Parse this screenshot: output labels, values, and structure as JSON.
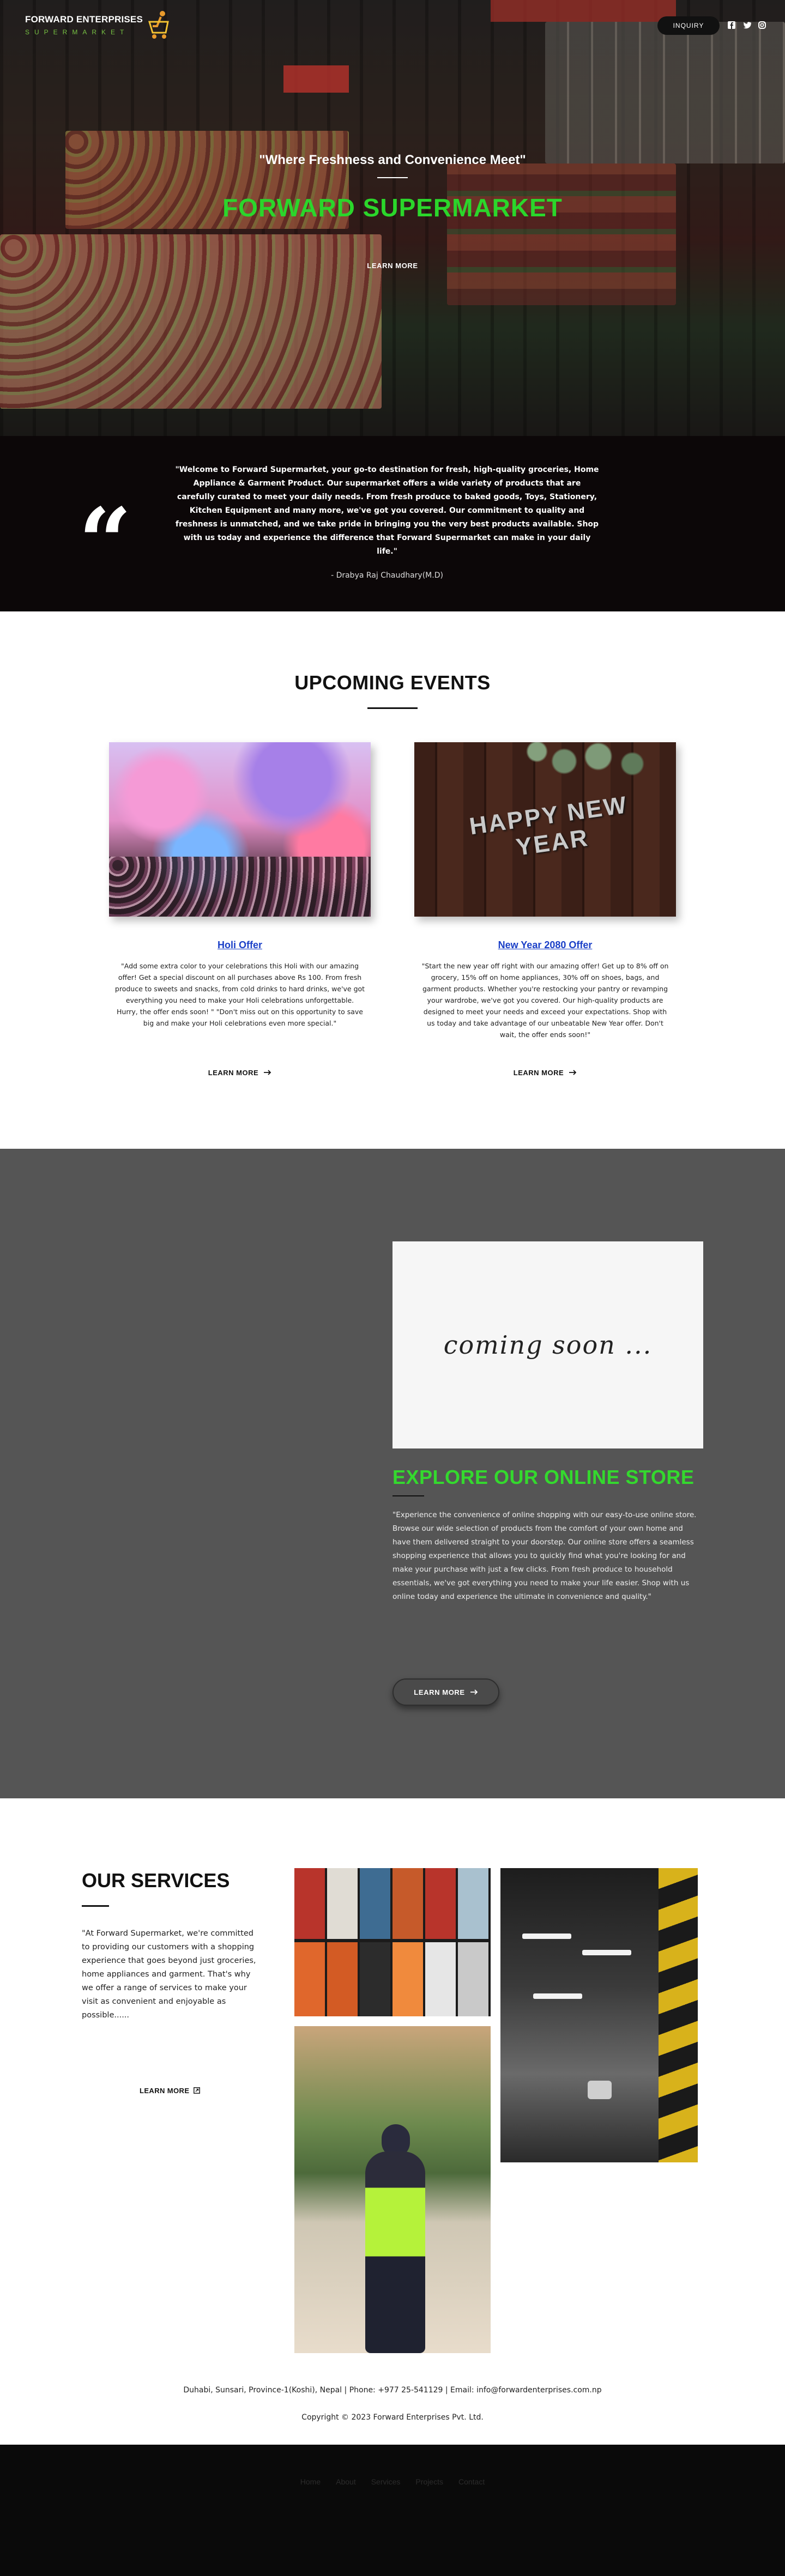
{
  "header": {
    "logo_title": "FORWARD ENTERPRISES",
    "logo_subtitle": "SUPERMARKET",
    "inquiry_label": "INQUIRY",
    "social_icons": [
      "facebook-icon",
      "twitter-icon",
      "instagram-icon"
    ]
  },
  "hero": {
    "quote": "\"Where Freshness and Convenience Meet\"",
    "title": "FORWARD SUPERMARKET",
    "cta_label": "LEARN MORE",
    "title_color": "#2bd62b"
  },
  "welcome": {
    "text": "\"Welcome to Forward Supermarket, your go-to destination for fresh, high-quality groceries, Home Appliance & Garment Product. Our supermarket offers a wide variety of products that are carefully curated to meet your daily needs. From fresh produce to baked goods, Toys, Stationery, Kitchen Equipment and many more, we've got you covered. Our commitment to quality and freshness is unmatched, and we take pride in bringing you the very best products available. Shop with us today and experience the difference that Forward Supermarket can make in your daily life.\"",
    "author": "- Drabya Raj Chaudhary(M.D)"
  },
  "events": {
    "title": "UPCOMING EVENTS",
    "items": [
      {
        "image_text": "",
        "title": "Holi Offer",
        "description": "\"Add some extra color to your celebrations this Holi with our amazing offer! Get a special discount on all purchases above Rs 100. From fresh produce to sweets and snacks, from cold drinks to hard drinks, we've got everything you need to make your Holi celebrations unforgettable. Hurry, the offer ends soon! \" \"Don't miss out on this opportunity to save big and make your Holi celebrations even more special.\"",
        "cta_label": "LEARN MORE"
      },
      {
        "image_text": "HAPPY NEW YEAR",
        "title": "New Year 2080 Offer",
        "description": "\"Start the new year off right with our amazing offer! Get up to 8% off on grocery, 15% off on home appliances, 30% off on shoes, bags, and garment products. Whether you're restocking your pantry or revamping your wardrobe, we've got you covered. Our high-quality products are designed to meet your needs and exceed your expectations. Shop with us today and take advantage of our unbeatable New Year offer. Don't wait, the offer ends soon!\"",
        "cta_label": "LEARN MORE"
      }
    ]
  },
  "store": {
    "image_text": "coming soon ...",
    "title": "EXPLORE OUR ONLINE STORE",
    "title_color": "#34d92e",
    "description": "\"Experience the convenience of online shopping with our easy-to-use online store. Browse our wide selection of products from the comfort of your own home and have them delivered straight to your doorstep. Our online store offers a seamless shopping experience that allows you to quickly find what you're looking for and make your purchase with just a few clicks. From fresh produce to household essentials, we've got everything you need to make your life easier. Shop with us online today and experience the ultimate in convenience and quality.\"",
    "cta_label": "LEARN MORE"
  },
  "services": {
    "title": "OUR SERVICES",
    "description": "\"At Forward Supermarket, we're committed to providing our customers with a shopping experience that goes beyond just groceries, home appliances and garment. That's why we offer a range of services to make your visit as convenient and enjoyable as possible......",
    "cta_label": "LEARN MORE"
  },
  "footer": {
    "contact": "Duhabi, Sunsari, Province-1(Koshi), Nepal | Phone: +977 25-541129 | Email: info@forwardenterprises.com.np",
    "copyright": "Copyright © 2023 Forward Enterprises Pvt. Ltd.",
    "nav": [
      "Home",
      "About",
      "Services",
      "Projects",
      "Contact"
    ]
  }
}
